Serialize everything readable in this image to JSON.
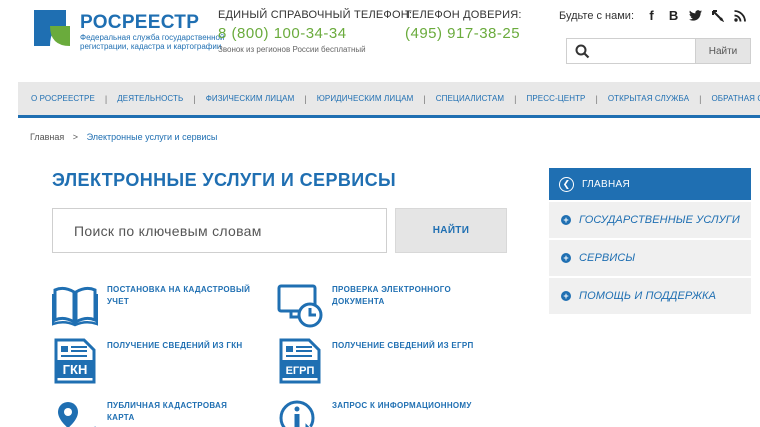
{
  "header": {
    "logo_title": "РОСРЕЕСТР",
    "logo_subtitle": "Федеральная служба государственной регистрации, кадастра и картографии",
    "helpline_label": "ЕДИНЫЙ СПРАВОЧНЫЙ ТЕЛЕФОН:",
    "helpline_number": "8 (800) 100-34-34",
    "helpline_note": "Звонок из регионов России бесплатный",
    "trust_label": "ТЕЛЕФОН ДОВЕРИЯ:",
    "trust_number": "(495) 917-38-25",
    "social_label": "Будьте с нами:",
    "social_icons": [
      "facebook-icon",
      "vk-icon",
      "twitter-icon",
      "livejournal-icon",
      "rss-icon"
    ],
    "search_button": "Найти"
  },
  "nav": {
    "items": [
      "О РОСРЕЕСТРЕ",
      "ДЕЯТЕЛЬНОСТЬ",
      "ФИЗИЧЕСКИМ ЛИЦАМ",
      "ЮРИДИЧЕСКИМ ЛИЦАМ",
      "СПЕЦИАЛИСТАМ",
      "ПРЕСС-ЦЕНТР",
      "ОТКРЫТАЯ СЛУЖБА",
      "ОБРАТНАЯ СВЯЗЬ"
    ],
    "separator": "|"
  },
  "breadcrumb": {
    "home": "Главная",
    "separator": ">",
    "current": "Электронные услуги и сервисы"
  },
  "main": {
    "title": "ЭЛЕКТРОННЫЕ УСЛУГИ И СЕРВИСЫ",
    "search_placeholder": "Поиск по ключевым словам",
    "search_button": "НАЙТИ",
    "services": [
      {
        "label": "ПОСТАНОВКА НА КАДАСТРОВЫЙ УЧЕТ",
        "icon": "book-icon"
      },
      {
        "label": "ПРОВЕРКА ЭЛЕКТРОННОГО ДОКУМЕНТА",
        "icon": "monitor-clock-icon"
      },
      {
        "label": "ПОЛУЧЕНИЕ СВЕДЕНИЙ ИЗ ГКН",
        "icon": "gkn-document-icon",
        "icon_text": "ГКН"
      },
      {
        "label": "ПОЛУЧЕНИЕ СВЕДЕНИЙ ИЗ ЕГРП",
        "icon": "egrp-document-icon",
        "icon_text": "ЕГРП"
      },
      {
        "label": "ПУБЛИЧНАЯ КАДАСТРОВАЯ КАРТА",
        "icon": "map-pin-icon"
      },
      {
        "label": "ЗАПРОС К ИНФОРМАЦИОННОМУ",
        "icon": "info-cursor-icon"
      }
    ]
  },
  "sidebar": {
    "home": "ГЛАВНАЯ",
    "items": [
      "ГОСУДАРСТВЕННЫЕ УСЛУГИ",
      "СЕРВИСЫ",
      "ПОМОЩЬ И ПОДДЕРЖКА"
    ]
  },
  "colors": {
    "brand_blue": "#1f6fb2",
    "phone_green": "#6aab3c",
    "nav_bg": "#e8e8e8"
  }
}
